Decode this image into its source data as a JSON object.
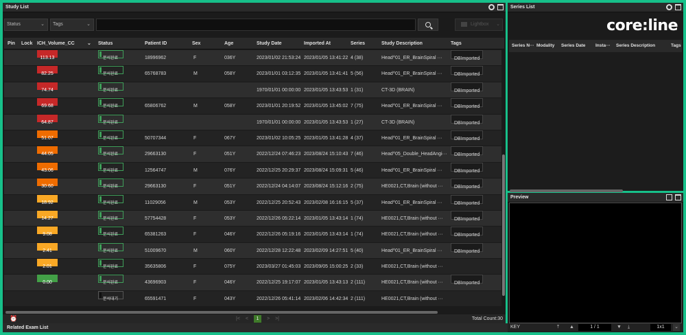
{
  "study_list": {
    "title": "Study List",
    "filters": {
      "status_label": "Status",
      "tags_label": "Tags",
      "search_value": "",
      "lightbox_label": "Lightbox"
    },
    "columns": [
      "Pin",
      "Lock",
      "ICH_Volume_CC",
      "Status",
      "Patient ID",
      "Sex",
      "Age",
      "Study Date",
      "Imported At",
      "Series",
      "Study Description",
      "Tags"
    ],
    "rows": [
      {
        "vol": "113.13",
        "volcolor": "#c62828",
        "status": "분석완료",
        "pid": "18996962",
        "sex": "F",
        "age": "036Y",
        "study_date": "2023/01/02 21:53:24",
        "imported": "2023/01/05 13:41:22",
        "series": "4 (38)",
        "desc": "Head^01_ER_BrainSpiral ···",
        "tag": "DBImported"
      },
      {
        "vol": "82.25",
        "volcolor": "#c62828",
        "status": "분석완료",
        "pid": "65768783",
        "sex": "M",
        "age": "058Y",
        "study_date": "2023/01/01 03:12:35",
        "imported": "2023/01/05 13:41:41",
        "series": "5 (56)",
        "desc": "Head^01_ER_BrainSpiral ···",
        "tag": "DBImported"
      },
      {
        "vol": "74.74",
        "volcolor": "#c62828",
        "status": "분석완료",
        "pid": "",
        "sex": "",
        "age": "",
        "study_date": "1970/01/01 00:00:00",
        "imported": "2023/01/05 13:43:53",
        "series": "1 (31)",
        "desc": "CT-3D (BRAIN)",
        "tag": "DBImported"
      },
      {
        "vol": "69.68",
        "volcolor": "#c62828",
        "status": "분석완료",
        "pid": "65806762",
        "sex": "M",
        "age": "058Y",
        "study_date": "2023/01/01 20:19:52",
        "imported": "2023/01/05 13:45:02",
        "series": "7 (75)",
        "desc": "Head^01_ER_BrainSpiral ···",
        "tag": "DBImported"
      },
      {
        "vol": "64.87",
        "volcolor": "#c62828",
        "status": "분석완료",
        "pid": "",
        "sex": "",
        "age": "",
        "study_date": "1970/01/01 00:00:00",
        "imported": "2023/01/05 13:43:53",
        "series": "1 (27)",
        "desc": "CT-3D (BRAIN)",
        "tag": "DBImported"
      },
      {
        "vol": "51.07",
        "volcolor": "#ef6c00",
        "status": "분석완료",
        "pid": "50707344",
        "sex": "F",
        "age": "067Y",
        "study_date": "2023/01/02 10:05:25",
        "imported": "2023/01/05 13:41:28",
        "series": "4 (37)",
        "desc": "Head^01_ER_BrainSpiral ···",
        "tag": "DBImported"
      },
      {
        "vol": "44.05",
        "volcolor": "#ef6c00",
        "status": "분석완료",
        "pid": "29663130",
        "sex": "F",
        "age": "051Y",
        "study_date": "2022/12/24 07:46:23",
        "imported": "2023/08/24 15:10:43",
        "series": "7 (46)",
        "desc": "Head^05_Double_HeadAngi···",
        "tag": "DBImported"
      },
      {
        "vol": "43.06",
        "volcolor": "#ef6c00",
        "status": "분석완료",
        "pid": "12564747",
        "sex": "M",
        "age": "076Y",
        "study_date": "2022/12/25 20:29:37",
        "imported": "2023/08/24 15:09:31",
        "series": "5 (46)",
        "desc": "Head^01_ER_BrainSpiral ···",
        "tag": "DBImported"
      },
      {
        "vol": "30.60",
        "volcolor": "#ef6c00",
        "status": "분석완료",
        "pid": "29663130",
        "sex": "F",
        "age": "051Y",
        "study_date": "2022/12/24 04:14:07",
        "imported": "2023/08/24 15:12:16",
        "series": "2 (75)",
        "desc": "HE0021,CT,Brain (without ···",
        "tag": "DBImported"
      },
      {
        "vol": "18.92",
        "volcolor": "#f9a825",
        "status": "분석완료",
        "pid": "11029056",
        "sex": "M",
        "age": "053Y",
        "study_date": "2022/12/25 20:52:43",
        "imported": "2023/02/08 16:16:15",
        "series": "5 (37)",
        "desc": "Head^01_ER_BrainSpiral ···",
        "tag": "DBImported"
      },
      {
        "vol": "14.27",
        "volcolor": "#f9a825",
        "status": "분석완료",
        "pid": "57754428",
        "sex": "F",
        "age": "053Y",
        "study_date": "2022/12/26 05:22:14",
        "imported": "2023/01/05 13:43:14",
        "series": "1 (74)",
        "desc": "HE0021,CT,Brain (without ···",
        "tag": "DBImported"
      },
      {
        "vol": "9.08",
        "volcolor": "#f9a825",
        "status": "분석완료",
        "pid": "65381263",
        "sex": "F",
        "age": "046Y",
        "study_date": "2022/12/26 05:19:16",
        "imported": "2023/01/05 13:43:14",
        "series": "1 (74)",
        "desc": "HE0021,CT,Brain (without ···",
        "tag": "DBImported"
      },
      {
        "vol": "2.41",
        "volcolor": "#f9a825",
        "status": "분석완료",
        "pid": "51009670",
        "sex": "M",
        "age": "060Y",
        "study_date": "2022/12/28 12:22:48",
        "imported": "2023/02/09 14:27:51",
        "series": "5 (40)",
        "desc": "Head^01_ER_BrainSpiral ···",
        "tag": "DBImported"
      },
      {
        "vol": "2.01",
        "volcolor": "#f9a825",
        "status": "분석완료",
        "pid": "35635806",
        "sex": "F",
        "age": "075Y",
        "study_date": "2023/03/27 01:45:03",
        "imported": "2023/09/05 15:00:25",
        "series": "2 (33)",
        "desc": "HE0021,CT,Brain (without ···",
        "tag": ""
      },
      {
        "vol": "0.00",
        "volcolor": "#43a047",
        "status": "분석완료",
        "pid": "43696903",
        "sex": "F",
        "age": "046Y",
        "study_date": "2022/12/25 19:17:07",
        "imported": "2023/01/05 13:43:13",
        "series": "2 (111)",
        "desc": "HE0021,CT,Brain (without ···",
        "tag": "DBImported"
      },
      {
        "vol": "",
        "volcolor": "",
        "status": "분석대기",
        "pid": "65591471",
        "sex": "F",
        "age": "043Y",
        "study_date": "2022/12/26 05:41:14",
        "imported": "2023/02/06 14:42:34",
        "series": "2 (111)",
        "desc": "HE0021,CT,Brain (without ···",
        "tag": ""
      }
    ],
    "pager": {
      "current": "1"
    },
    "total": "Total Count:30"
  },
  "related": {
    "title": "Related Exam List"
  },
  "series_list": {
    "title": "Series List",
    "logo": "core:line",
    "columns": [
      "Series N···",
      "Modality",
      "Series Date",
      "Insta···",
      "Series Description",
      "Tags"
    ]
  },
  "preview": {
    "title": "Preview",
    "key_label": "KEY",
    "page": "1 / 1",
    "layout": "1x1"
  }
}
